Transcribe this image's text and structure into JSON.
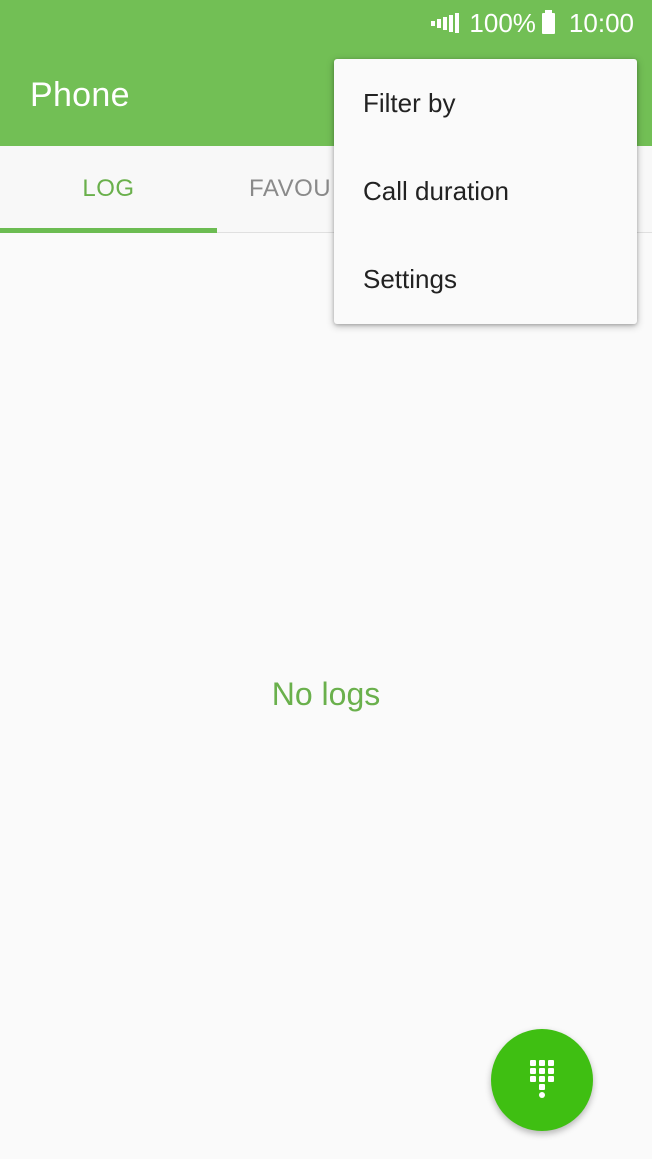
{
  "status_bar": {
    "battery_percent": "100%",
    "time": "10:00",
    "icons": [
      "signal-icon",
      "battery-icon"
    ]
  },
  "app_bar": {
    "title": "Phone",
    "color": "#72bf55"
  },
  "tabs": [
    {
      "label": "LOG",
      "active": true
    },
    {
      "label": "FAVOU",
      "active": false
    }
  ],
  "main": {
    "empty_message": "No logs"
  },
  "fab": {
    "icon": "dialpad-icon",
    "color": "#3fbf12"
  },
  "overflow_menu": {
    "items": [
      {
        "label": "Filter by"
      },
      {
        "label": "Call duration"
      },
      {
        "label": "Settings"
      }
    ]
  }
}
